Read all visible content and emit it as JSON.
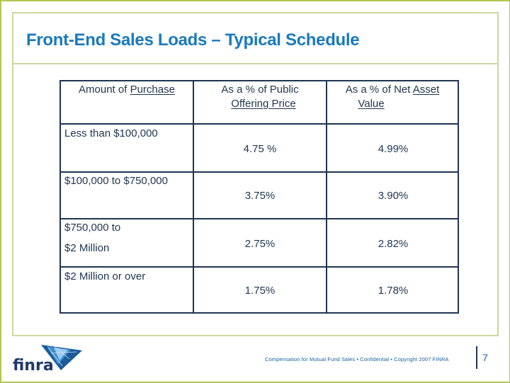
{
  "slide": {
    "title": "Front-End Sales Loads – Typical Schedule",
    "table": {
      "headers": [
        {
          "pre": "Amount of ",
          "underlined": "Purchase",
          "line2": ""
        },
        {
          "pre": "As a % of Public",
          "underlined": "",
          "line2": "Offering Price"
        },
        {
          "pre": "As a % of Net ",
          "underlined": "Asset",
          "line2": "Value"
        }
      ],
      "rows": [
        {
          "amount": [
            "Less than $100,000"
          ],
          "public_offering_price": "4.75 %",
          "net_asset_value": "4.99%"
        },
        {
          "amount": [
            "$100,000 to $750,000"
          ],
          "public_offering_price": "3.75%",
          "net_asset_value": "3.90%"
        },
        {
          "amount": [
            "$750,000 to",
            "$2 Million"
          ],
          "public_offering_price": "2.75%",
          "net_asset_value": "2.82%"
        },
        {
          "amount": [
            "$2 Million or over"
          ],
          "public_offering_price": "1.75%",
          "net_asset_value": "1.78%"
        }
      ]
    },
    "footer": {
      "logo_text": "FINRA",
      "caption": "Compensation for Mutual Fund Sales  •  Confidential  •  Copyright 2007 FINRA",
      "page_number": "7"
    },
    "colors": {
      "title": "#1a79bd",
      "table_border": "#1f3550",
      "text": "#1f3550",
      "outer_frame": "#b3c64f",
      "inner_frame": "#cbd89b",
      "footer_text": "#1b5fa0"
    }
  }
}
